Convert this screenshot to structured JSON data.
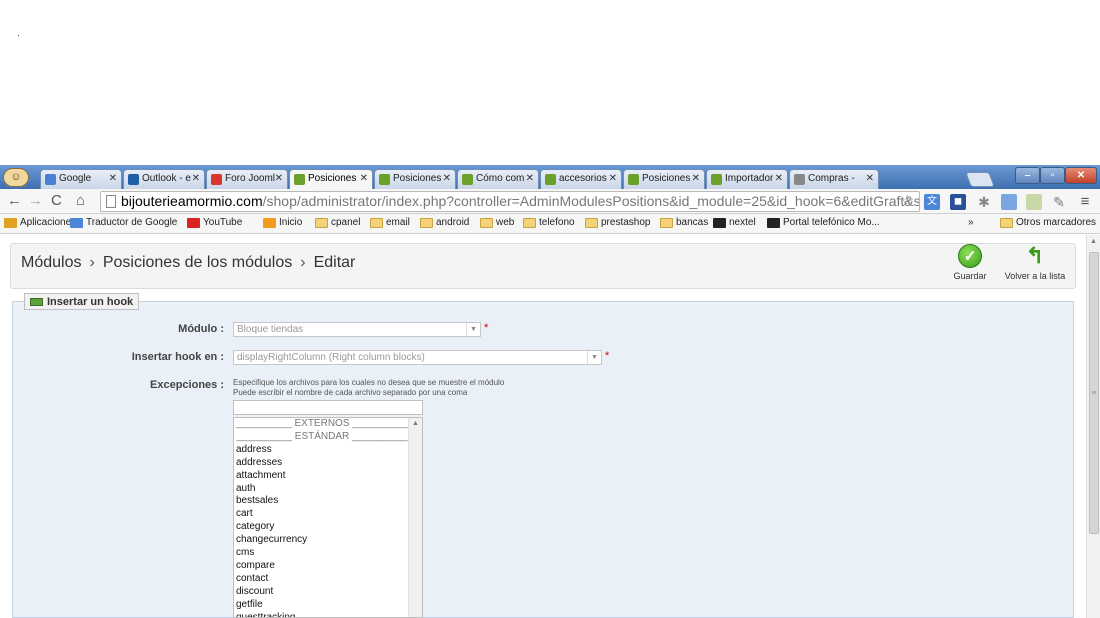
{
  "browser": {
    "tabs": [
      {
        "label": "Google",
        "color": "#4a7fd4"
      },
      {
        "label": "Outlook - e",
        "color": "#1e5fa8"
      },
      {
        "label": "Foro Jooml",
        "color": "#d9352c"
      },
      {
        "label": "Posiciones",
        "color": "#6aa12a",
        "active": true
      },
      {
        "label": "Posiciones",
        "color": "#6aa12a"
      },
      {
        "label": "Cómo com",
        "color": "#6aa12a"
      },
      {
        "label": "accesorios",
        "color": "#6aa12a"
      },
      {
        "label": "Posiciones",
        "color": "#6aa12a"
      },
      {
        "label": "Importador",
        "color": "#6aa12a"
      },
      {
        "label": "Compras -",
        "color": "#888888"
      }
    ],
    "url_host": "bijouterieamormio.com",
    "url_path": "/shop/administrator/index.php?controller=AdminModulesPositions&id_module=25&id_hook=6&editGraft&show_",
    "bookmarks": [
      {
        "label": "Aplicaciones",
        "icon": "apps-grid-icon"
      },
      {
        "label": "Traductor de Google",
        "icon": "translate-icon"
      },
      {
        "label": "YouTube",
        "icon": "youtube-icon"
      },
      {
        "label": "Inicio",
        "icon": "joomla-icon"
      },
      {
        "label": "cpanel",
        "icon": "folder-icon"
      },
      {
        "label": "email",
        "icon": "folder-icon"
      },
      {
        "label": "android",
        "icon": "folder-icon"
      },
      {
        "label": "web",
        "icon": "folder-icon"
      },
      {
        "label": "telefono",
        "icon": "folder-icon"
      },
      {
        "label": "prestashop",
        "icon": "folder-icon"
      },
      {
        "label": "bancas",
        "icon": "folder-icon"
      },
      {
        "label": "nextel",
        "icon": "nextel-icon"
      },
      {
        "label": "Portal telefónico Mo...",
        "icon": "nextel-icon"
      }
    ],
    "bookmarks_overflow": "»",
    "other_bookmarks": "Otros marcadores"
  },
  "header": {
    "breadcrumb": [
      "Módulos",
      "Posiciones de los módulos",
      "Editar"
    ],
    "breadcrumb_sep": "›",
    "save_label": "Guardar",
    "back_label": "Volver a la lista"
  },
  "form": {
    "legend": "Insertar un hook",
    "module_label": "Módulo :",
    "module_value": "Bloque tiendas",
    "hook_label": "Insertar hook en :",
    "hook_value": "displayRightColumn (Right column blocks)",
    "required_mark": "*",
    "exceptions_label": "Excepciones :",
    "help_line1": "Especifique los archivos para los cuales no desea que se muestre el módulo",
    "help_line2": "Puede escribir el nombre de cada archivo separado por una coma",
    "list_groups": [
      "__________ EXTERNOS __________",
      "__________ ESTÁNDAR __________"
    ],
    "list_items": [
      "address",
      "addresses",
      "attachment",
      "auth",
      "bestsales",
      "cart",
      "category",
      "changecurrency",
      "cms",
      "compare",
      "contact",
      "discount",
      "getfile",
      "guesttracking"
    ]
  },
  "colors": {
    "accent_green": "#3a9c1c",
    "tabstrip_blue": "#3e6fb0"
  }
}
